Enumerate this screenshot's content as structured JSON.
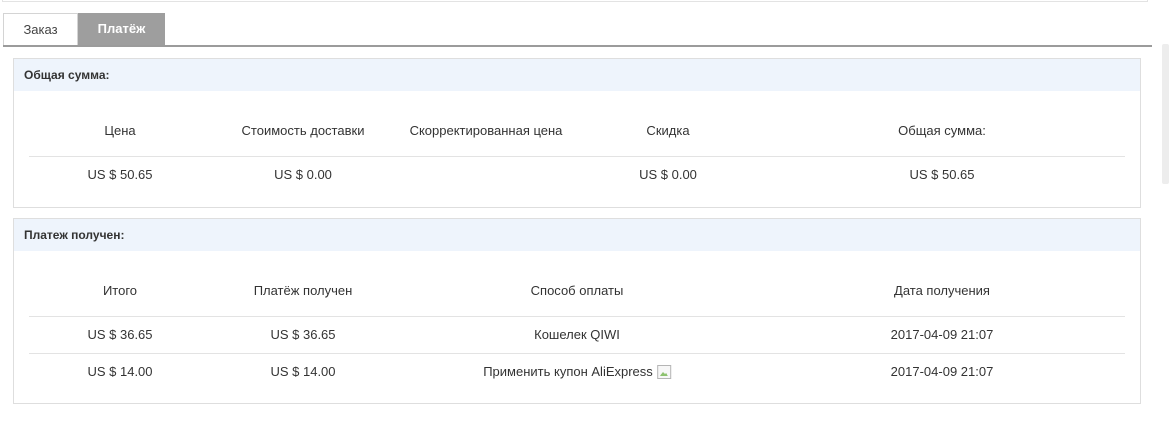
{
  "tabs": [
    {
      "label": "Заказ",
      "active": false
    },
    {
      "label": "Платёж",
      "active": true
    }
  ],
  "total_panel": {
    "title": "Общая сумма:",
    "headers": [
      "Цена",
      "Стоимость доставки",
      "Скорректированная цена",
      "Скидка",
      "Общая сумма:"
    ],
    "values": [
      "US $ 50.65",
      "US $ 0.00",
      "",
      "US $ 0.00",
      "US $ 50.65"
    ]
  },
  "payment_panel": {
    "title": "Платеж получен:",
    "headers": [
      "Итого",
      "Платёж получен",
      "Способ оплаты",
      "Дата получения"
    ],
    "rows": [
      [
        "US $ 36.65",
        "US $ 36.65",
        "Кошелек QIWI",
        "2017-04-09 21:07"
      ],
      [
        "US $ 14.00",
        "US $ 14.00",
        "Применить купон AliExpress",
        "2017-04-09 21:07"
      ]
    ]
  },
  "colors": {
    "panel_header_bg": "#eef4fc",
    "active_tab_bg": "#9e9e9e",
    "border": "#dedede"
  },
  "icons": {
    "coupon": "broken-image-icon"
  }
}
